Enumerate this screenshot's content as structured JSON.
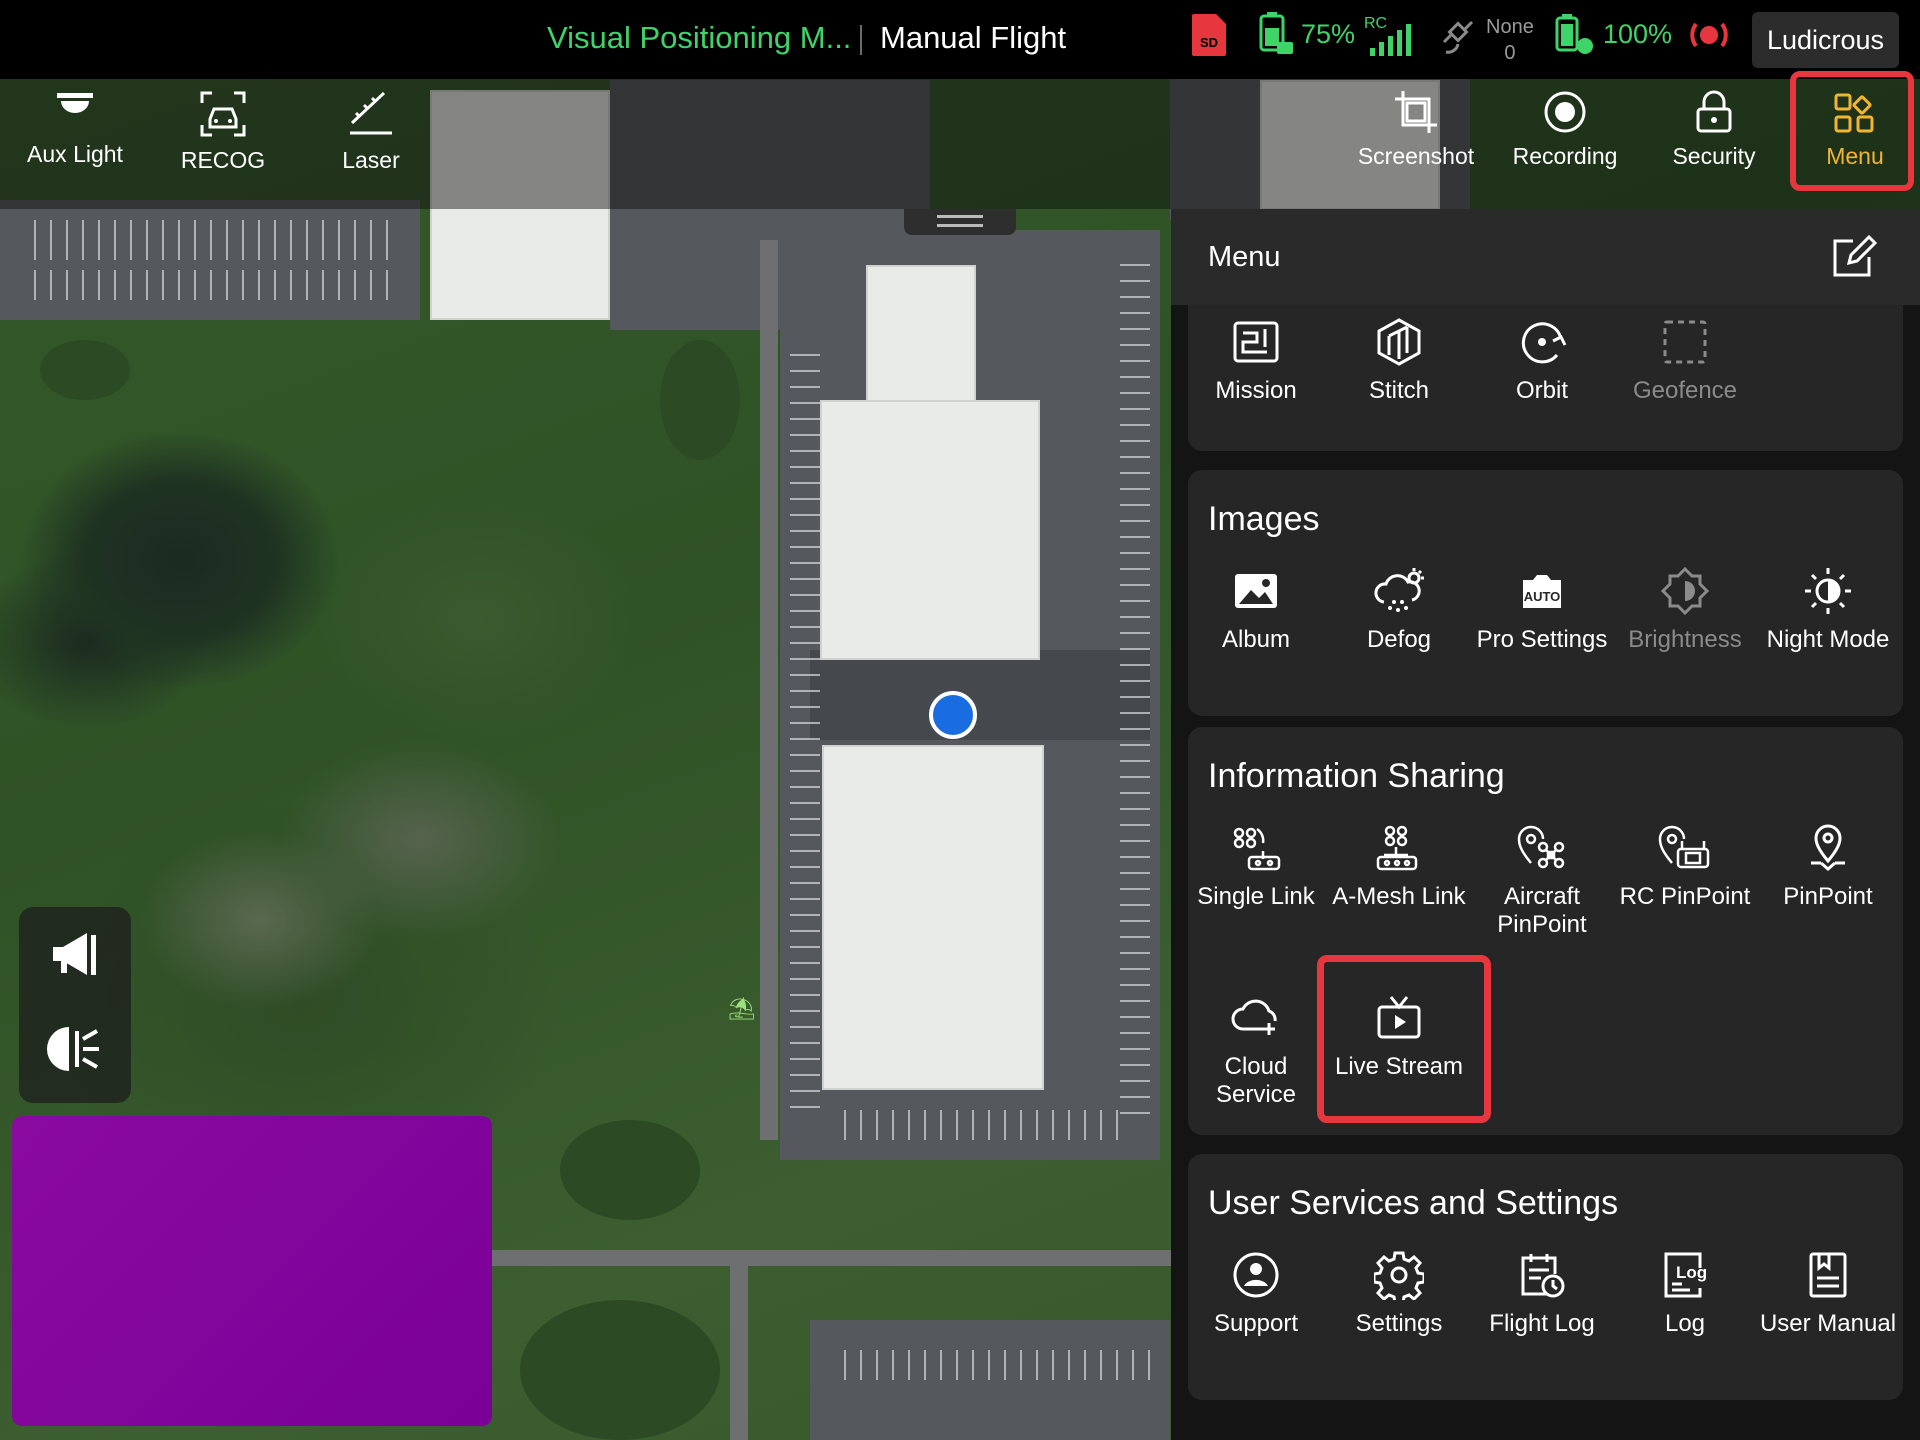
{
  "status_bar": {
    "positioning_mode": "Visual Positioning M...",
    "flight_mode": "Manual Flight",
    "sd_label": "SD",
    "aircraft_battery": "75%",
    "rc_label": "RC",
    "gps_status": "None",
    "gps_count": "0",
    "rc_battery": "100%",
    "speed_mode": "Ludicrous"
  },
  "toolbar": {
    "left": [
      {
        "label": "Aux Light",
        "icon": "aux-light-icon"
      },
      {
        "label": "RECOG",
        "icon": "recog-icon"
      },
      {
        "label": "Laser",
        "icon": "laser-icon"
      }
    ],
    "right": [
      {
        "label": "Screenshot",
        "icon": "screenshot-icon"
      },
      {
        "label": "Recording",
        "icon": "recording-icon"
      },
      {
        "label": "Security",
        "icon": "lock-icon"
      },
      {
        "label": "Menu",
        "icon": "menu-grid-icon"
      }
    ]
  },
  "menu": {
    "title": "Menu",
    "sections": [
      {
        "title": "",
        "items": [
          {
            "label": "Mission",
            "icon": "mission-icon",
            "enabled": true
          },
          {
            "label": "Stitch",
            "icon": "stitch-icon",
            "enabled": true
          },
          {
            "label": "Orbit",
            "icon": "orbit-icon",
            "enabled": true
          },
          {
            "label": "Geofence",
            "icon": "geofence-icon",
            "enabled": false
          }
        ]
      },
      {
        "title": "Images",
        "items": [
          {
            "label": "Album",
            "icon": "album-icon",
            "enabled": true
          },
          {
            "label": "Defog",
            "icon": "defog-icon",
            "enabled": true
          },
          {
            "label": "Pro Settings",
            "icon": "auto-icon",
            "enabled": true
          },
          {
            "label": "Brightness",
            "icon": "brightness-icon",
            "enabled": false
          },
          {
            "label": "Night Mode",
            "icon": "night-mode-icon",
            "enabled": true
          }
        ]
      },
      {
        "title": "Information Sharing",
        "items": [
          {
            "label": "Single Link",
            "icon": "single-link-icon",
            "enabled": true
          },
          {
            "label": "A-Mesh Link",
            "icon": "a-mesh-link-icon",
            "enabled": true
          },
          {
            "label": "Aircraft\nPinPoint",
            "icon": "aircraft-pinpoint-icon",
            "enabled": true
          },
          {
            "label": "RC PinPoint",
            "icon": "rc-pinpoint-icon",
            "enabled": true
          },
          {
            "label": "PinPoint",
            "icon": "pinpoint-icon",
            "enabled": true
          },
          {
            "label": "Cloud\nService",
            "icon": "cloud-service-icon",
            "enabled": true
          },
          {
            "label": "Live Stream",
            "icon": "live-stream-icon",
            "enabled": true
          }
        ]
      },
      {
        "title": "User Services and Settings",
        "items": [
          {
            "label": "Support",
            "icon": "support-icon",
            "enabled": true
          },
          {
            "label": "Settings",
            "icon": "gear-icon",
            "enabled": true
          },
          {
            "label": "Flight Log",
            "icon": "flight-log-icon",
            "enabled": true
          },
          {
            "label": "Log",
            "icon": "log-icon",
            "enabled": true
          },
          {
            "label": "User Manual",
            "icon": "user-manual-icon",
            "enabled": true
          }
        ]
      }
    ]
  },
  "colors": {
    "accent_green": "#3fd46a",
    "highlight_red": "#e8363e",
    "panel_bg": "#141414",
    "card_bg": "#262626"
  }
}
